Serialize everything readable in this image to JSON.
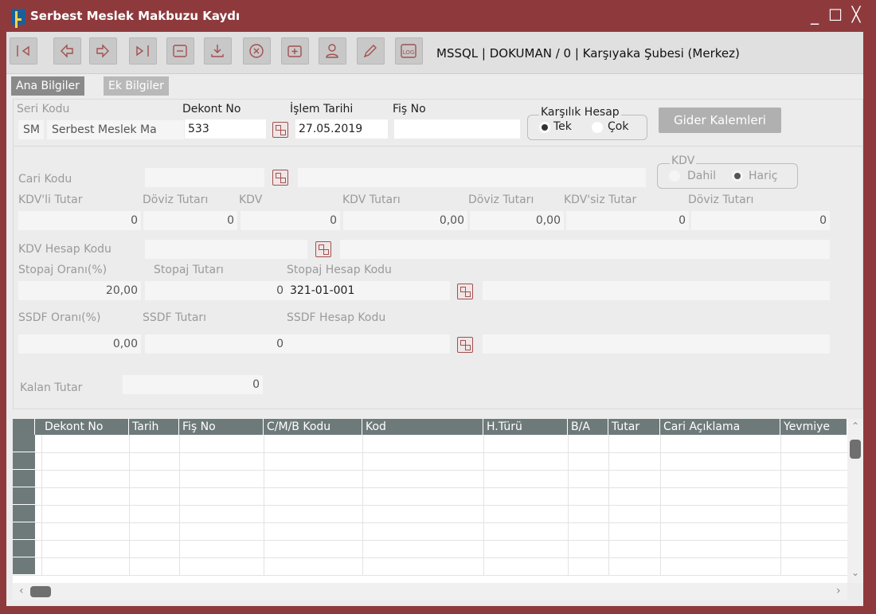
{
  "window": {
    "title": "Serbest Meslek Makbuzu Kaydı",
    "minimize": "_",
    "maximize": "☐",
    "close": "╳"
  },
  "toolbar": {
    "server_info": "MSSQL | DOKUMAN / 0 | Karşıyaka Şubesi (Merkez)",
    "buttons": [
      "first-icon",
      "prev-icon",
      "next-icon",
      "last-icon",
      "list-icon",
      "download-icon",
      "cancel-icon",
      "new-record-icon",
      "user-icon",
      "edit-icon",
      "log-icon"
    ],
    "log_label": "LOG"
  },
  "tabs": [
    {
      "label": "Ana Bilgiler",
      "active": true
    },
    {
      "label": "Ek Bilgiler",
      "active": false
    }
  ],
  "form": {
    "seri_kodu_label": "Seri Kodu",
    "seri_kodu_code": "SM",
    "seri_kodu_name": "Serbest Meslek Ma",
    "dekont_no_label": "Dekont No",
    "dekont_no": "533",
    "islem_tarihi_label": "İşlem Tarihi",
    "islem_tarihi": "27.05.2019",
    "fis_no_label": "Fiş No",
    "fis_no": "",
    "karsilik_label": "Karşılık Hesap",
    "karsilik_tek": "Tek",
    "karsilik_cok": "Çok",
    "karsilik_selected": "Tek",
    "gider_button": "Gider Kalemleri",
    "cari_kodu_label": "Cari Kodu",
    "kdv_group_label": "KDV",
    "kdv_dahil": "Dahil",
    "kdv_haric": "Hariç",
    "kdv_selected": "Hariç",
    "kdvli_tutar_label": "KDV'li Tutar",
    "kdvli_tutar": "0",
    "doviz_tutari_label": "Döviz Tutarı",
    "doviz_tutari_1": "0",
    "kdv_label": "KDV",
    "kdv": "0",
    "kdv_tutari_label": "KDV Tutarı",
    "kdv_tutari": "0,00",
    "doviz_tutari_2": "0,00",
    "kdvsiz_tutar_label": "KDV'siz Tutar",
    "kdvsiz_tutar": "0",
    "doviz_tutari_3": "0",
    "kdv_hesap_kodu_label": "KDV Hesap Kodu",
    "stopaj_orani_label": "Stopaj Oranı(%)",
    "stopaj_orani": "20,00",
    "stopaj_tutari_label": "Stopaj Tutarı",
    "stopaj_tutari": "0",
    "stopaj_hesap_kodu_label": "Stopaj Hesap Kodu",
    "stopaj_hesap_kodu": "321-01-001",
    "ssdf_orani_label": "SSDF Oranı(%)",
    "ssdf_orani": "0,00",
    "ssdf_tutari_label": "SSDF Tutarı",
    "ssdf_tutari": "0",
    "ssdf_hesap_kodu_label": "SSDF Hesap Kodu",
    "kalan_tutar_label": "Kalan Tutar",
    "kalan_tutar": "0"
  },
  "grid": {
    "columns": [
      "Dekont No",
      "Tarih",
      "Fiş No",
      "C/M/B Kodu",
      "Kod",
      "H.Türü",
      "B/A",
      "Tutar",
      "Cari Açıklama",
      "Yevmiye"
    ],
    "empty_rows": 8
  },
  "scroll": {
    "up": "⌃",
    "down": "⌄",
    "left": "‹",
    "right": "›"
  },
  "colors": {
    "title_bar": "#8e3a3c",
    "grid_header": "#6e7a7a",
    "accent_icon": "#a25050"
  }
}
